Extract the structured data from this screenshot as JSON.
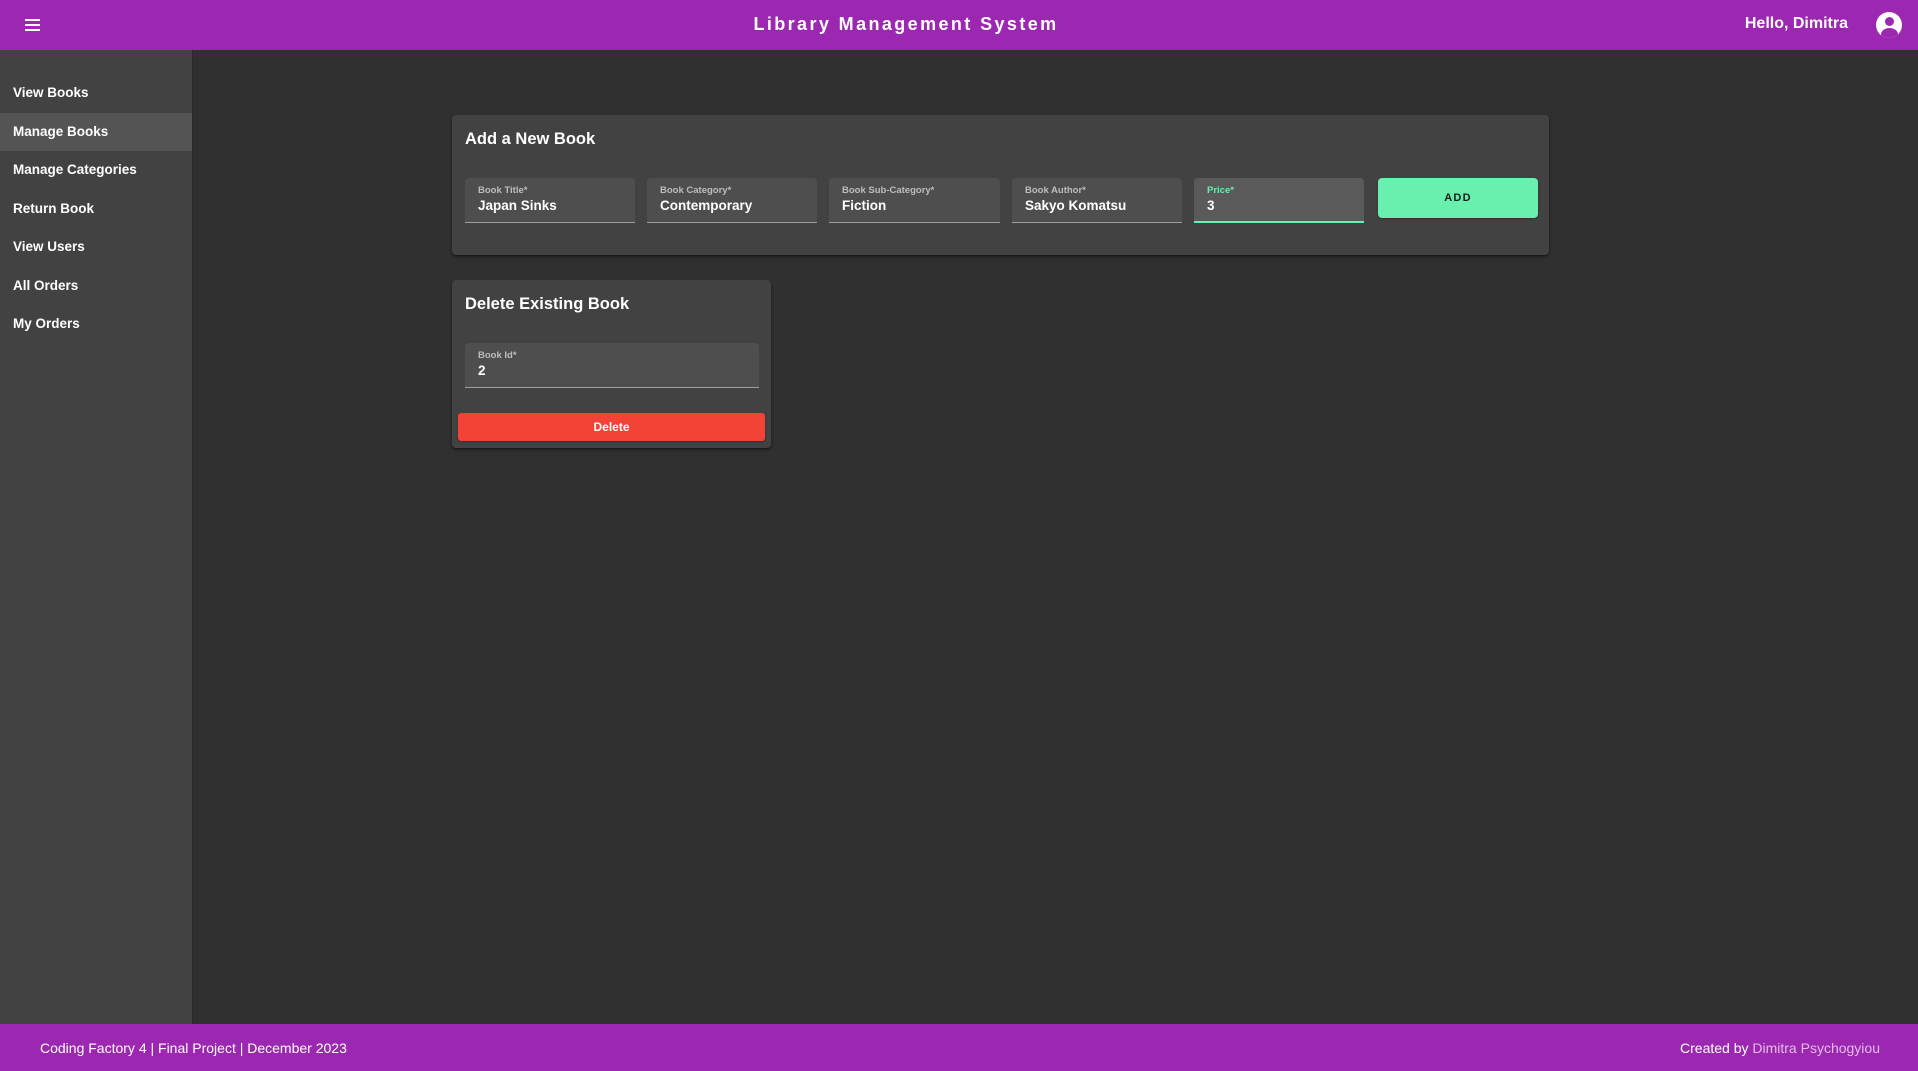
{
  "header": {
    "title": "Library Management System",
    "greeting": "Hello, Dimitra",
    "menu_icon": "hamburger-menu-icon",
    "account_icon": "account-circle-icon"
  },
  "sidebar": {
    "items": [
      {
        "label": "View Books"
      },
      {
        "label": "Manage Books",
        "active": true
      },
      {
        "label": "Manage Categories"
      },
      {
        "label": "Return Book"
      },
      {
        "label": "View Users"
      },
      {
        "label": "All Orders"
      },
      {
        "label": "My Orders"
      }
    ]
  },
  "add_book": {
    "title": "Add a New Book",
    "fields": [
      {
        "label": "Book Title*",
        "value": "Japan Sinks"
      },
      {
        "label": "Book Category*",
        "value": "Contemporary"
      },
      {
        "label": "Book Sub-Category*",
        "value": "Fiction"
      },
      {
        "label": "Book Author*",
        "value": "Sakyo Komatsu"
      },
      {
        "label": "Price*",
        "value": "3",
        "focused": true
      }
    ],
    "button_label": "ADD"
  },
  "delete_book": {
    "title": "Delete Existing Book",
    "field": {
      "label": "Book Id*",
      "value": "2"
    },
    "button_label": "Delete"
  },
  "footer": {
    "left_text": "Coding Factory 4 | Final Project | December 2023",
    "created_by": "Created by",
    "author_link": "Dimitra Psychogyiou"
  },
  "colors": {
    "primary": "#9c27b0",
    "accent": "#69f0ae",
    "warn": "#f44336",
    "background": "#303030",
    "surface": "#424242"
  }
}
